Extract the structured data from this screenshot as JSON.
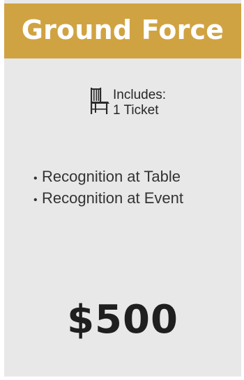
{
  "card": {
    "title": "Ground Force",
    "includes": {
      "icon": "chair-icon",
      "label": "Includes:",
      "value": "1 Ticket"
    },
    "benefits": [
      "Recognition at Table",
      "Recognition at Event"
    ],
    "price": "$500"
  },
  "colors": {
    "header": "#d0a342",
    "card_background": "#e8e8e8",
    "title_text": "#ffffff",
    "body_text": "#333333"
  }
}
